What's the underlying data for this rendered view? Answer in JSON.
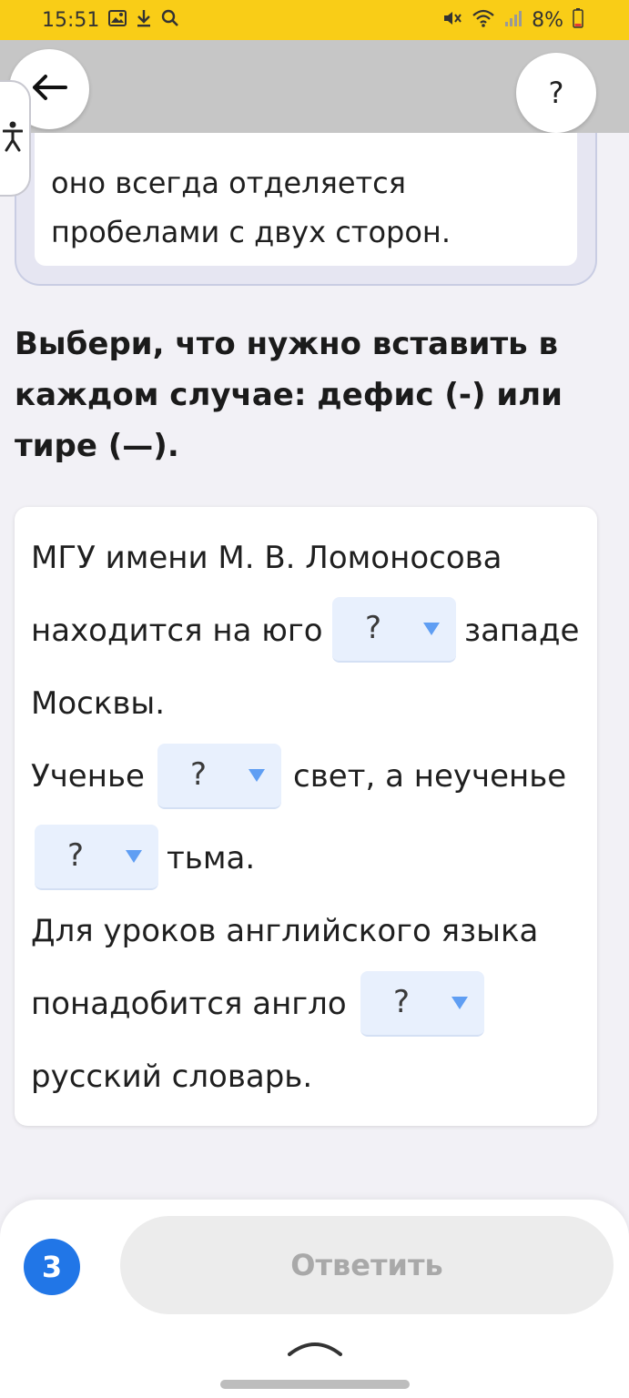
{
  "status_bar": {
    "time": "15:51",
    "battery": "8%",
    "icons_left": [
      "gallery-icon",
      "download-icon",
      "search-icon"
    ],
    "icons_right": [
      "mute-icon",
      "wifi-icon",
      "signal-icon",
      "battery-icon"
    ]
  },
  "toolbar": {
    "back_icon": "arrow-left-icon",
    "help_label": "?"
  },
  "tip": {
    "line1": "оно всегда отделяется",
    "line2": "пробелами с двух сторон."
  },
  "instruction": "Выбери, что нужно вставить в каждом случае: дефис (-) или тире (—).",
  "exercise": {
    "s1_a": "МГУ имени М. В. Ломоносова",
    "s1_b": "находится на юго",
    "s1_c": "западе",
    "s1_d": "Москвы.",
    "s2_a": "Ученье",
    "s2_b": "свет, а неученье",
    "s2_c": "тьма.",
    "s3_a": "Для уроков английского языка",
    "s3_b": "понадобится англо",
    "s3_c": "русский словарь.",
    "dropdown_value": "?"
  },
  "bottom": {
    "counter": "3",
    "answer_label": "Ответить"
  },
  "colors": {
    "status_bar": "#f9cd17",
    "accent_blue": "#2176e7",
    "dropdown_bg": "#e8f0fd",
    "dropdown_arrow": "#5f9ef3"
  }
}
